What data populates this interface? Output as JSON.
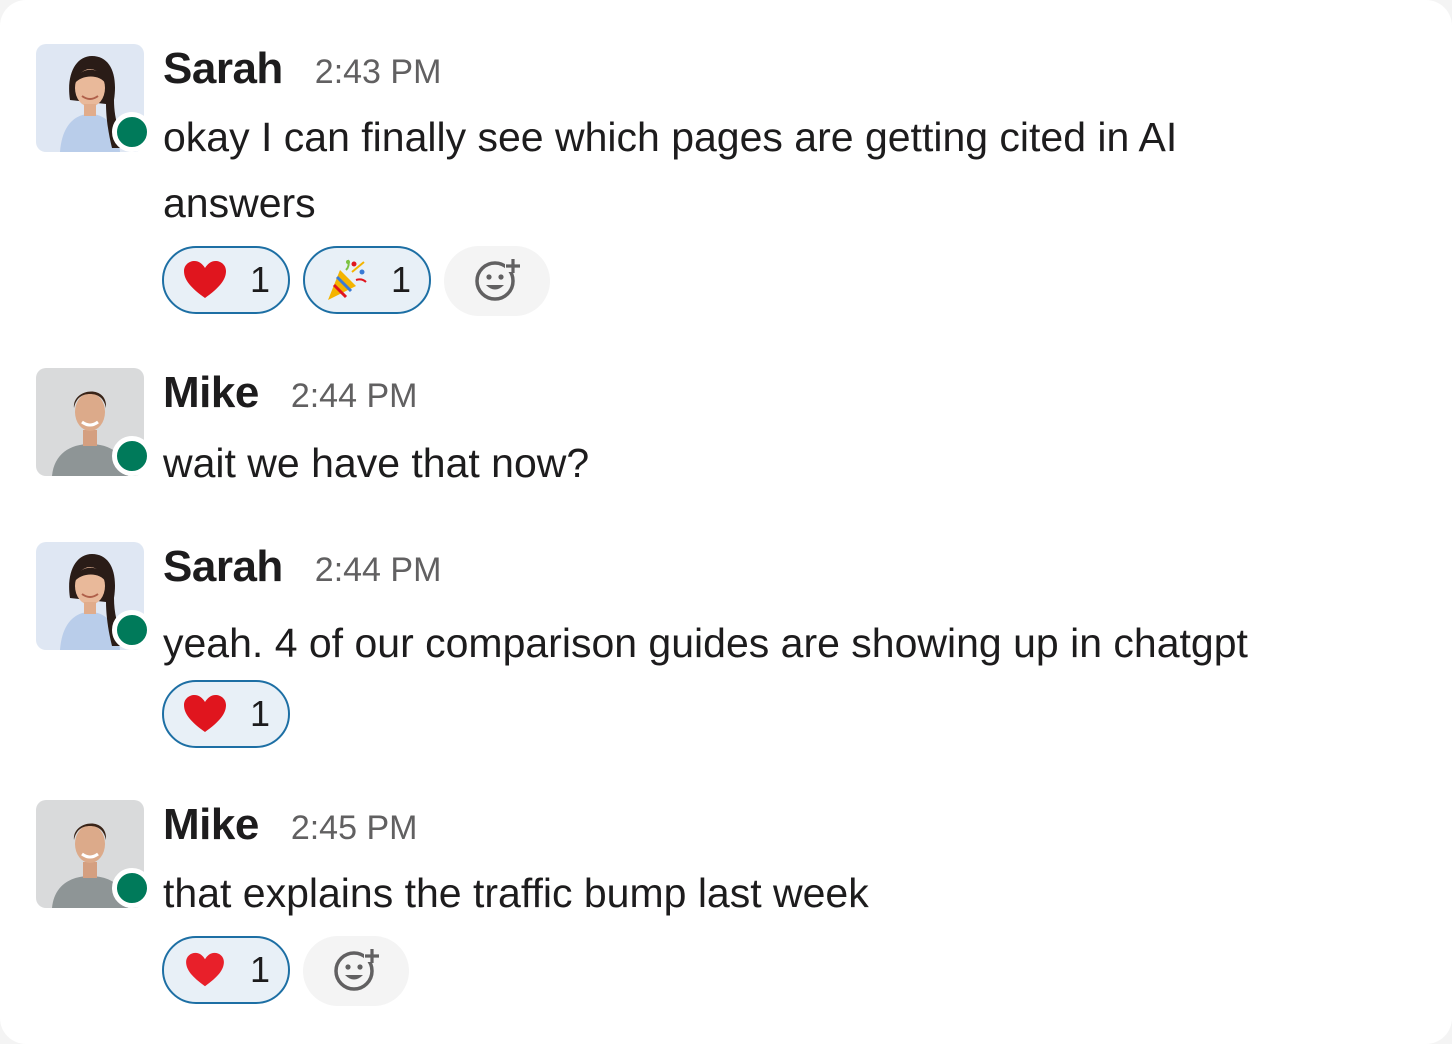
{
  "messages": [
    {
      "author": "Sarah",
      "time": "2:43 PM",
      "text": "okay I can finally see which pages are getting cited in AI answers",
      "reactions": [
        {
          "emoji": "heart-icon",
          "count": "1"
        },
        {
          "emoji": "party-popper-icon",
          "count": "1"
        }
      ],
      "has_add_reaction": true
    },
    {
      "author": "Mike",
      "time": "2:44 PM",
      "text": "wait we have that now?",
      "reactions": [],
      "has_add_reaction": false
    },
    {
      "author": "Sarah",
      "time": "2:44 PM",
      "text": "yeah. 4 of our comparison guides are showing up in chatgpt",
      "reactions": [
        {
          "emoji": "heart-icon",
          "count": "1"
        }
      ],
      "has_add_reaction": false
    },
    {
      "author": "Mike",
      "time": "2:45 PM",
      "text": "that explains the traffic bump last week",
      "reactions": [
        {
          "emoji": "heart-icon",
          "count": "1"
        }
      ],
      "has_add_reaction": true
    }
  ],
  "colors": {
    "presence_online": "#007a5a",
    "reaction_border": "#1d6fa4",
    "reaction_bg": "#e8f0f7",
    "heart": "#e0151e",
    "text": "#1d1c1d",
    "timestamp": "#616061"
  }
}
